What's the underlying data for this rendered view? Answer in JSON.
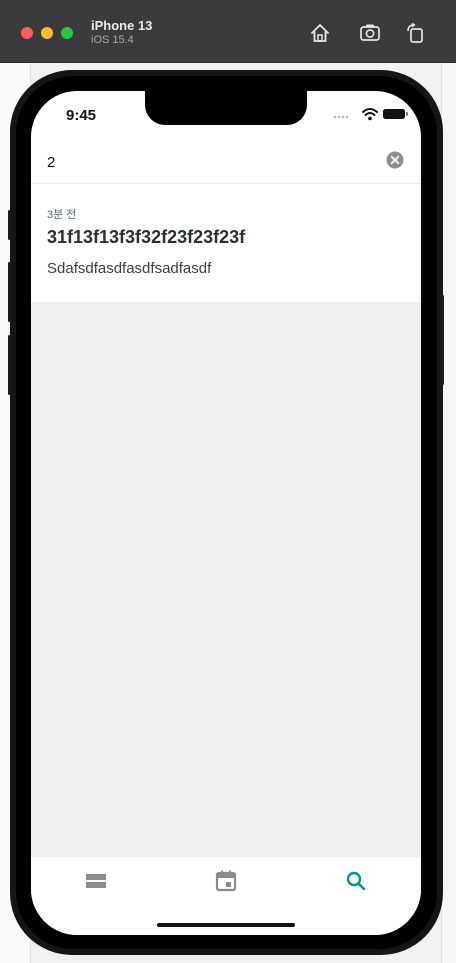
{
  "simulator": {
    "device_name": "iPhone 13",
    "os_version": "iOS 15.4",
    "toolbar_icons": [
      "home-icon",
      "screenshot-icon",
      "rotate-icon"
    ]
  },
  "status_bar": {
    "time": "9:45",
    "icons": [
      "signal-icon",
      "wifi-icon",
      "battery-icon"
    ]
  },
  "search": {
    "query": "2",
    "clear_icon": "clear-circle-icon"
  },
  "results": [
    {
      "time_ago": "3분 전",
      "title": "31f13f13f3f32f23f23f23f",
      "body": "Sdafsdfasdfasdfsadfasdf"
    }
  ],
  "tab_bar": {
    "tabs": [
      {
        "icon": "list-icon",
        "active": false
      },
      {
        "icon": "calendar-icon",
        "active": false
      },
      {
        "icon": "search-icon",
        "active": true
      }
    ],
    "active_color": "#00968f",
    "inactive_color": "#8a8a8a"
  }
}
